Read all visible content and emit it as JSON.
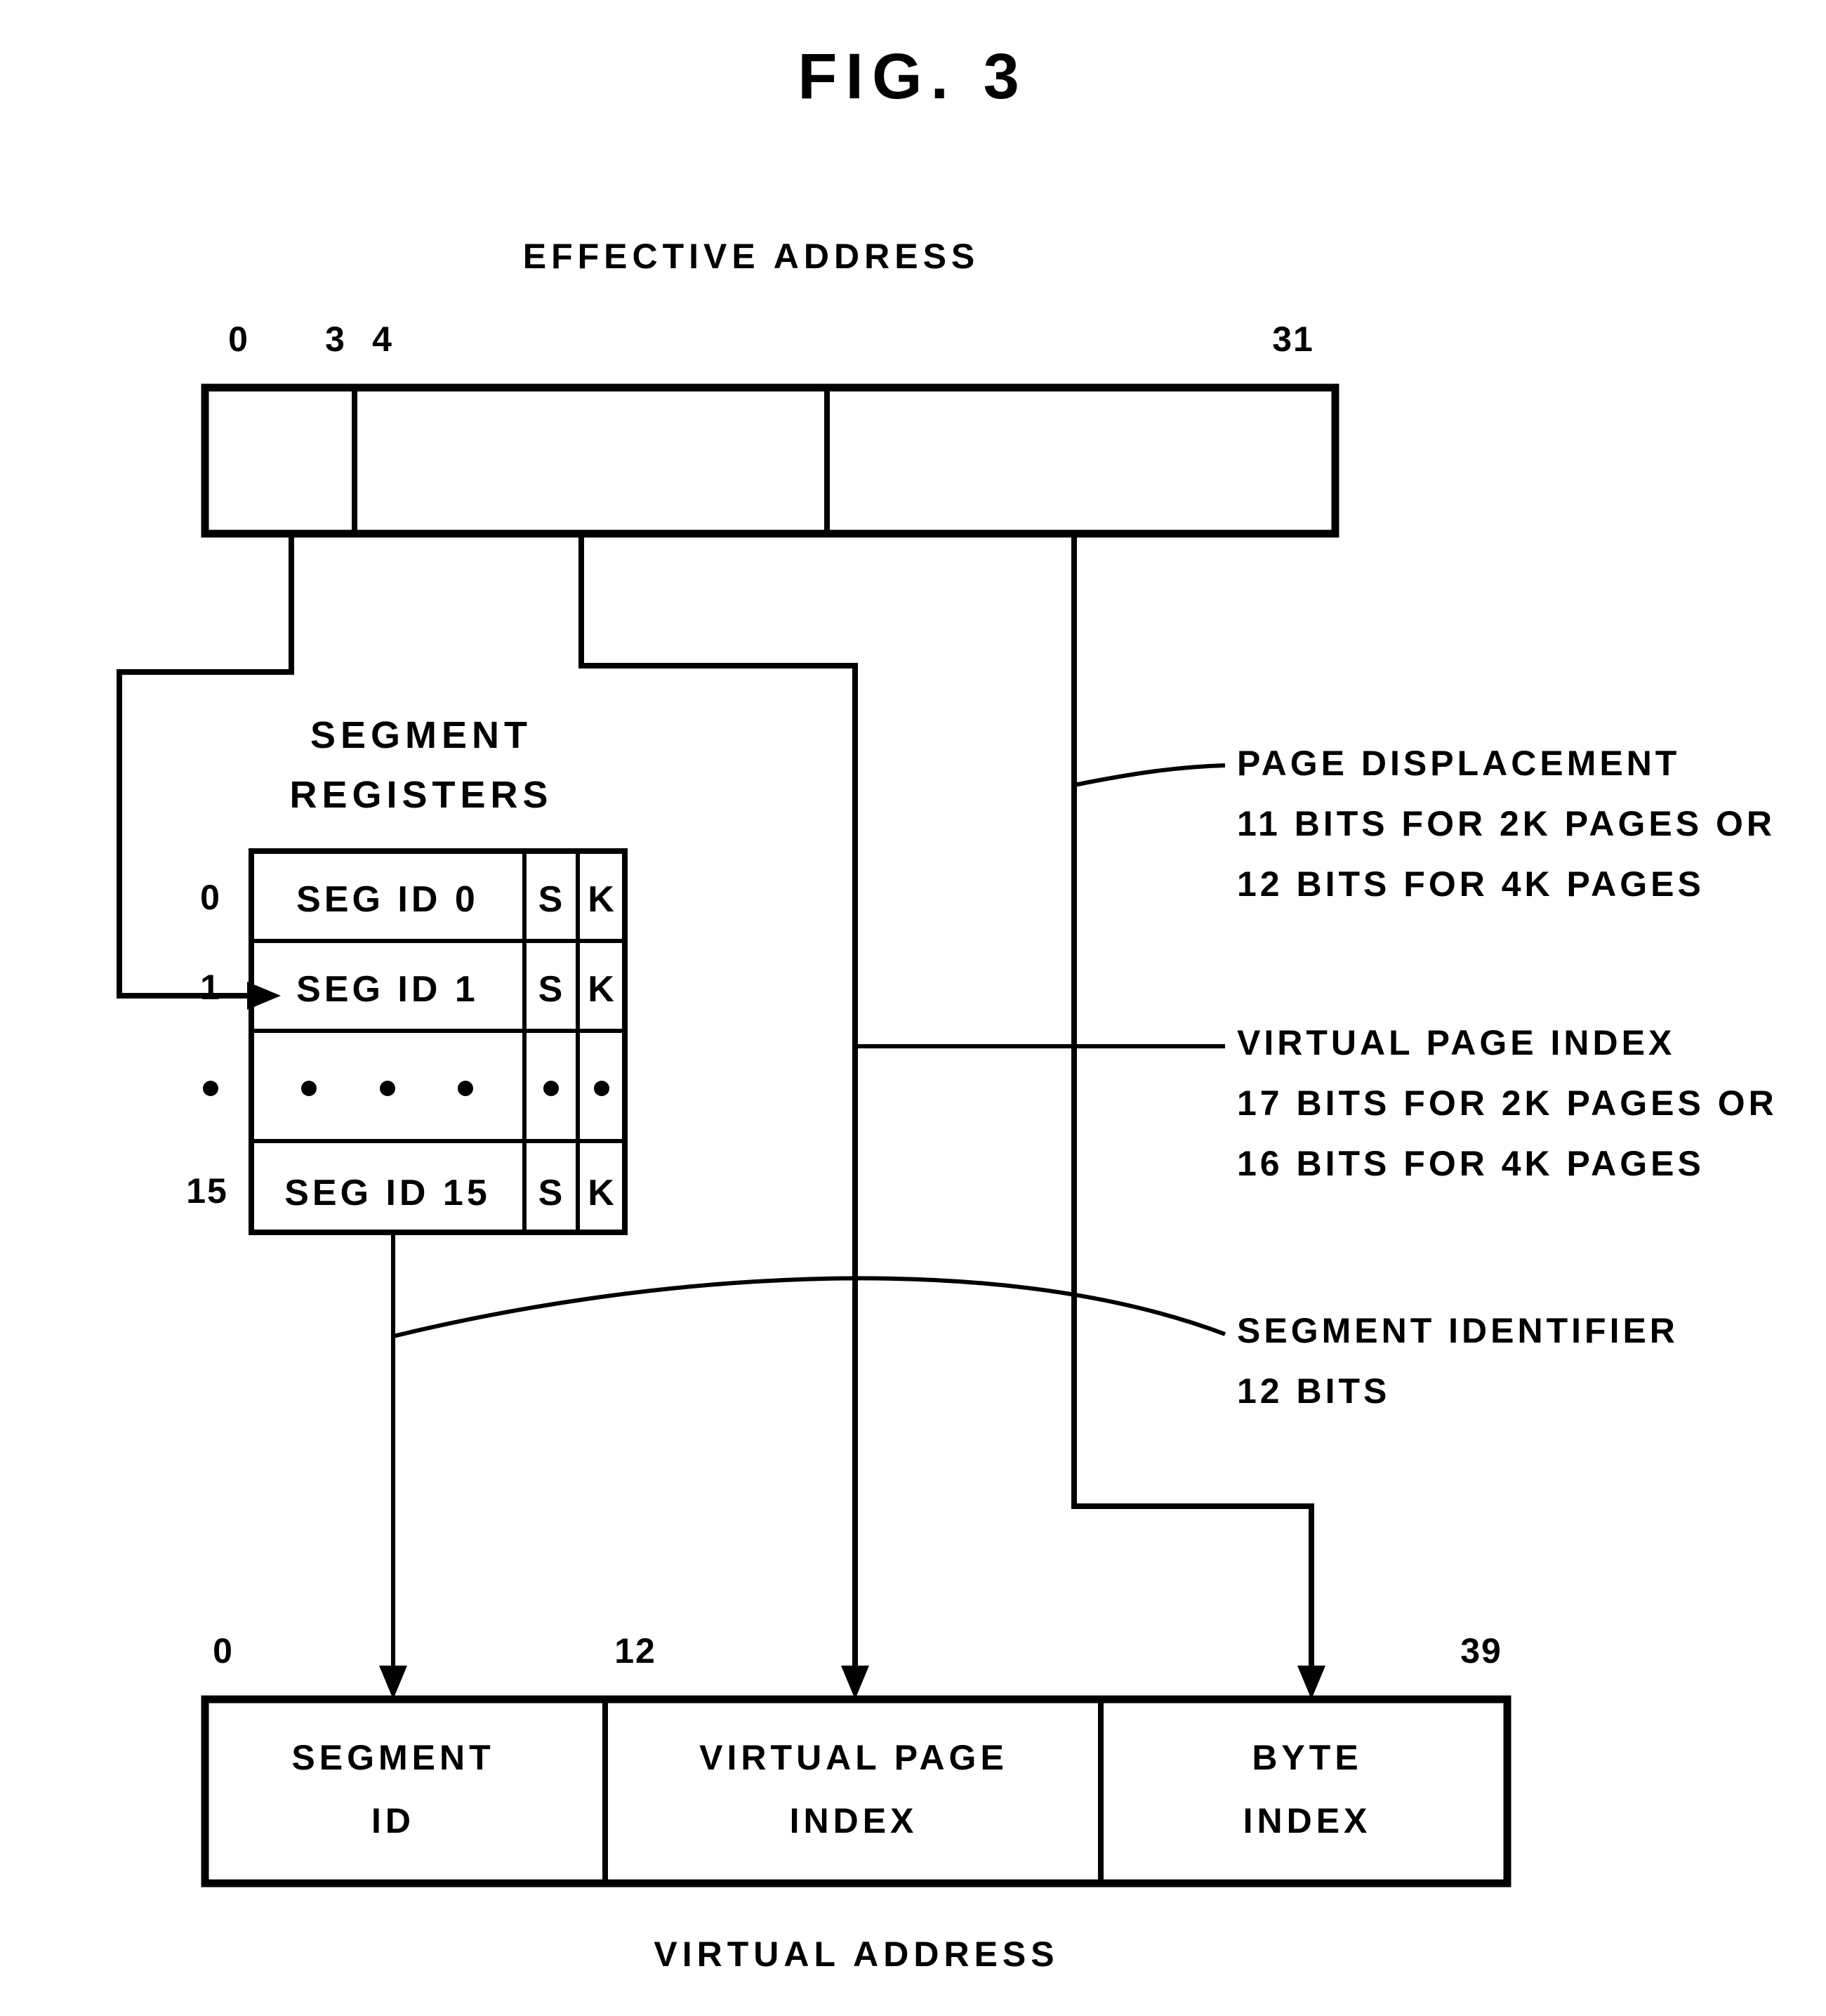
{
  "figure": {
    "title": "FIG. 3",
    "top_label": "EFFECTIVE ADDRESS",
    "bottom_label": "VIRTUAL ADDRESS"
  },
  "effective_address": {
    "bit_labels": {
      "start": "0",
      "seg_end": "3",
      "idx_start": "4",
      "end": "31"
    },
    "fields": [
      {
        "name": "segment-selector",
        "label": ""
      },
      {
        "name": "virtual-page-index",
        "label": ""
      },
      {
        "name": "page-displacement",
        "label": ""
      }
    ]
  },
  "segment_registers": {
    "title_line1": "SEGMENT",
    "title_line2": "REGISTERS",
    "flag_headers": {
      "s": "S",
      "k": "K"
    },
    "rows": [
      {
        "index": "0",
        "value": "SEG ID 0",
        "s": "S",
        "k": "K"
      },
      {
        "index": "1",
        "value": "SEG ID 1",
        "s": "S",
        "k": "K"
      },
      {
        "index": "•",
        "value": "ellipsis",
        "s": "•",
        "k": "•"
      },
      {
        "index": "15",
        "value": "SEG ID 15",
        "s": "S",
        "k": "K"
      }
    ]
  },
  "annotations": [
    {
      "name": "page-displacement",
      "lines": [
        "PAGE DISPLACEMENT",
        "11 BITS FOR 2K PAGES OR",
        "12 BITS FOR  4K PAGES"
      ]
    },
    {
      "name": "virtual-page-index",
      "lines": [
        "VIRTUAL PAGE INDEX",
        "17 BITS FOR 2K PAGES OR",
        "16 BITS FOR 4K PAGES"
      ]
    },
    {
      "name": "segment-identifier",
      "lines": [
        "SEGMENT IDENTIFIER",
        "12 BITS"
      ]
    }
  ],
  "virtual_address": {
    "bit_labels": {
      "start": "0",
      "mid": "12",
      "end": "39"
    },
    "fields": [
      {
        "name": "segment-id",
        "line1": "SEGMENT",
        "line2": "ID"
      },
      {
        "name": "virtual-page-index",
        "line1": "VIRTUAL PAGE",
        "line2": "INDEX"
      },
      {
        "name": "byte-index",
        "line1": "BYTE",
        "line2": "INDEX"
      }
    ]
  },
  "colors": {
    "ink": "#000000",
    "paper": "#ffffff"
  }
}
